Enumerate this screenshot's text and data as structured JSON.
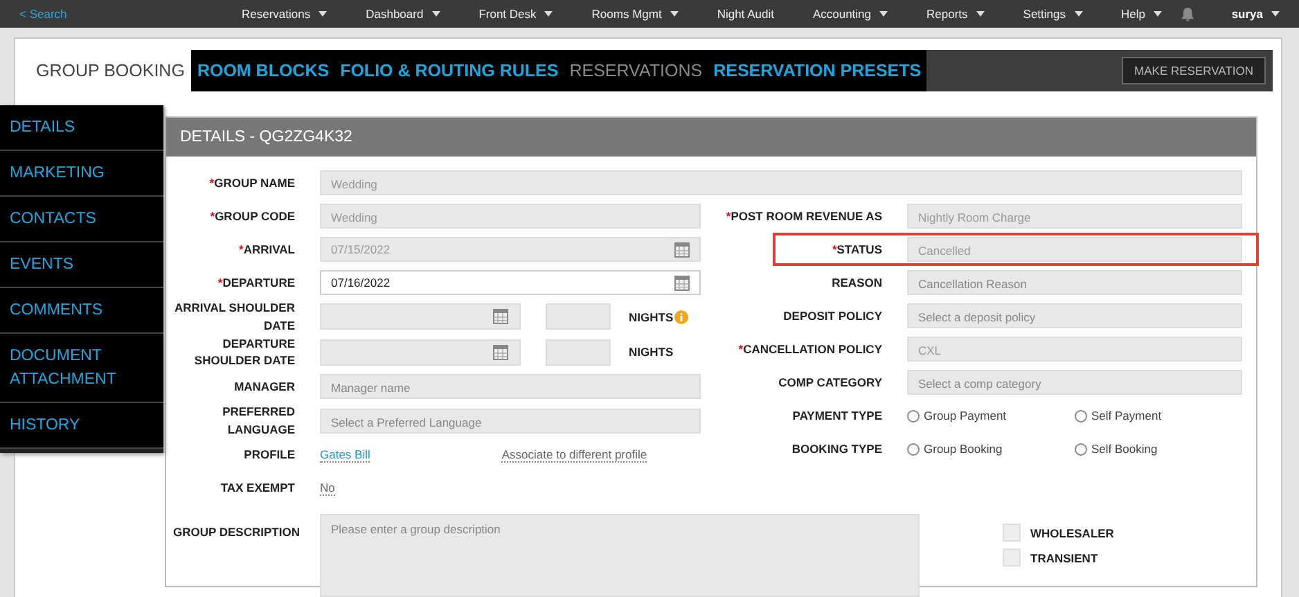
{
  "top_nav": {
    "back_link": "< Search",
    "menu": [
      {
        "label": "Reservations",
        "dropdown": true
      },
      {
        "label": "Dashboard",
        "dropdown": true
      },
      {
        "label": "Front Desk",
        "dropdown": true
      },
      {
        "label": "Rooms Mgmt",
        "dropdown": true
      },
      {
        "label": "Night Audit",
        "dropdown": false
      },
      {
        "label": "Accounting",
        "dropdown": true
      },
      {
        "label": "Reports",
        "dropdown": true
      },
      {
        "label": "Settings",
        "dropdown": true
      },
      {
        "label": "Help",
        "dropdown": true
      }
    ],
    "user": "surya"
  },
  "tabs": [
    {
      "label": "GROUP BOOKING",
      "selected": true,
      "disabled": false
    },
    {
      "label": "ROOM BLOCKS",
      "selected": false,
      "disabled": false
    },
    {
      "label": "FOLIO & ROUTING RULES",
      "selected": false,
      "disabled": false
    },
    {
      "label": "RESERVATIONS",
      "selected": false,
      "disabled": true
    },
    {
      "label": "RESERVATION PRESETS",
      "selected": false,
      "disabled": false
    }
  ],
  "make_reservation_button": "MAKE RESERVATION",
  "sidebar": [
    {
      "label": "DETAILS"
    },
    {
      "label": "MARKETING"
    },
    {
      "label": "CONTACTS"
    },
    {
      "label": "EVENTS"
    },
    {
      "label": "COMMENTS"
    },
    {
      "label": "DOCUMENT ATTACHMENT"
    },
    {
      "label": "HISTORY"
    }
  ],
  "details": {
    "title": "DETAILS - QG2ZG4K32",
    "group_name": {
      "label": "GROUP NAME",
      "required_mark": "*",
      "value": "Wedding",
      "disabled": true
    },
    "left_fields": [
      {
        "kind": "text",
        "label": "GROUP CODE",
        "required_mark": "*",
        "value": "Wedding",
        "disabled": true
      },
      {
        "kind": "date",
        "label": "ARRIVAL",
        "required_mark": "*",
        "value": "07/15/2022",
        "disabled": true
      },
      {
        "kind": "date",
        "label": "DEPARTURE",
        "required_mark": "*",
        "value": "07/16/2022",
        "disabled": false
      },
      {
        "kind": "shoulder",
        "label": "ARRIVAL SHOULDER DATE",
        "nights_label": "NIGHTS",
        "info": true
      },
      {
        "kind": "shoulder",
        "label": "DEPARTURE SHOULDER DATE",
        "nights_label": "NIGHTS",
        "info": false
      },
      {
        "kind": "text",
        "label": "MANAGER",
        "placeholder": "Manager name",
        "disabled": true
      },
      {
        "kind": "text",
        "label": "PREFERRED LANGUAGE",
        "placeholder": "Select a Preferred Language",
        "disabled": true
      },
      {
        "kind": "links",
        "label": "PROFILE",
        "links": [
          "Gates Bill",
          "Associate to different profile"
        ]
      },
      {
        "kind": "value",
        "label": "TAX EXEMPT",
        "value": "No"
      }
    ],
    "right_fields": [
      {
        "kind": "text",
        "label": "POST ROOM REVENUE AS",
        "required_mark": "*",
        "value": "Nightly Room Charge",
        "disabled": true,
        "highlighted": false
      },
      {
        "kind": "text",
        "label": "STATUS",
        "required_mark": "*",
        "value": "Cancelled",
        "disabled": true,
        "highlighted": true
      },
      {
        "kind": "text",
        "label": "REASON",
        "placeholder": "Cancellation Reason",
        "disabled": true,
        "highlighted": false
      },
      {
        "kind": "text",
        "label": "DEPOSIT POLICY",
        "placeholder": "Select a deposit policy",
        "disabled": true,
        "highlighted": false
      },
      {
        "kind": "text",
        "label": "CANCELLATION POLICY",
        "required_mark": "*",
        "value": "CXL",
        "disabled": true,
        "highlighted": false
      },
      {
        "kind": "text",
        "label": "COMP CATEGORY",
        "placeholder": "Select a comp category",
        "disabled": true,
        "highlighted": false
      },
      {
        "kind": "radio",
        "label": "PAYMENT TYPE",
        "options": [
          {
            "label": "Group Payment",
            "selected": false
          },
          {
            "label": "Self Payment",
            "selected": false
          }
        ]
      },
      {
        "kind": "radio",
        "label": "BOOKING TYPE",
        "options": [
          {
            "label": "Group Booking",
            "selected": false
          },
          {
            "label": "Self Booking",
            "selected": false
          }
        ]
      }
    ],
    "group_description": {
      "label": "GROUP DESCRIPTION",
      "placeholder": "Please enter a group description"
    },
    "flags": [
      {
        "label": "WHOLESALER",
        "checked": false
      },
      {
        "label": "TRANSIENT",
        "checked": false
      }
    ]
  }
}
